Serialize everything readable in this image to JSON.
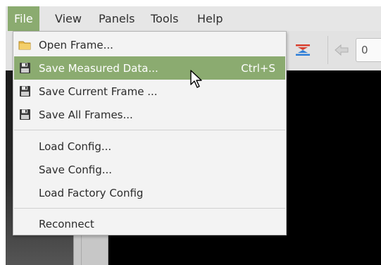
{
  "menubar": {
    "items": [
      {
        "label": "File"
      },
      {
        "label": "View"
      },
      {
        "label": "Panels"
      },
      {
        "label": "Tools"
      },
      {
        "label": "Help"
      }
    ]
  },
  "toolbar": {
    "frame_number_value": "0",
    "icons": [
      "flip-icon",
      "previous-frame-arrow-icon"
    ]
  },
  "file_menu": {
    "items": [
      {
        "label": "Open Frame...",
        "shortcut": "",
        "icon": "folder-icon"
      },
      {
        "label": "Save Measured Data...",
        "shortcut": "Ctrl+S",
        "icon": "floppy-disk-icon",
        "highlighted": true
      },
      {
        "label": "Save Current Frame ...",
        "shortcut": "",
        "icon": "floppy-disk-icon"
      },
      {
        "label": "Save All Frames...",
        "shortcut": "",
        "icon": "floppy-disk-icon"
      },
      {
        "label": "Load Config...",
        "shortcut": "",
        "icon": ""
      },
      {
        "label": "Save Config...",
        "shortcut": "",
        "icon": ""
      },
      {
        "label": "Load Factory Config",
        "shortcut": "",
        "icon": ""
      },
      {
        "label": "Reconnect",
        "shortcut": "",
        "icon": ""
      }
    ]
  },
  "colors": {
    "accent_highlight": "#8bab70",
    "menu_background": "#f3f3f3",
    "image_view_background": "#000000"
  }
}
